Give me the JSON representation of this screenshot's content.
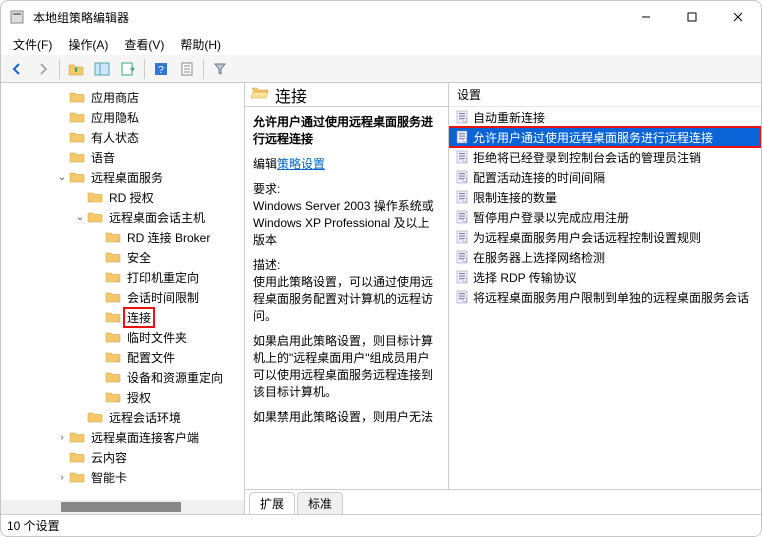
{
  "window": {
    "title": "本地组策略编辑器"
  },
  "menu": {
    "file": "文件(F)",
    "action": "操作(A)",
    "view": "查看(V)",
    "help": "帮助(H)"
  },
  "tree": {
    "items": [
      {
        "indent": 3,
        "twisty": "",
        "label": "应用商店",
        "sel": false
      },
      {
        "indent": 3,
        "twisty": "",
        "label": "应用隐私",
        "sel": false
      },
      {
        "indent": 3,
        "twisty": "",
        "label": "有人状态",
        "sel": false
      },
      {
        "indent": 3,
        "twisty": "",
        "label": "语音",
        "sel": false
      },
      {
        "indent": 3,
        "twisty": "v",
        "label": "远程桌面服务",
        "sel": false
      },
      {
        "indent": 4,
        "twisty": "",
        "label": "RD 授权",
        "sel": false
      },
      {
        "indent": 4,
        "twisty": "v",
        "label": "远程桌面会话主机",
        "sel": false
      },
      {
        "indent": 5,
        "twisty": "",
        "label": "RD 连接 Broker",
        "sel": false
      },
      {
        "indent": 5,
        "twisty": "",
        "label": "安全",
        "sel": false
      },
      {
        "indent": 5,
        "twisty": "",
        "label": "打印机重定向",
        "sel": false
      },
      {
        "indent": 5,
        "twisty": "",
        "label": "会话时间限制",
        "sel": false
      },
      {
        "indent": 5,
        "twisty": "",
        "label": "连接",
        "sel": true
      },
      {
        "indent": 5,
        "twisty": "",
        "label": "临时文件夹",
        "sel": false
      },
      {
        "indent": 5,
        "twisty": "",
        "label": "配置文件",
        "sel": false
      },
      {
        "indent": 5,
        "twisty": "",
        "label": "设备和资源重定向",
        "sel": false
      },
      {
        "indent": 5,
        "twisty": "",
        "label": "授权",
        "sel": false
      },
      {
        "indent": 4,
        "twisty": "",
        "label": "远程会话环境",
        "sel": false
      },
      {
        "indent": 3,
        "twisty": ">",
        "label": "远程桌面连接客户端",
        "sel": false
      },
      {
        "indent": 3,
        "twisty": "",
        "label": "云内容",
        "sel": false
      },
      {
        "indent": 3,
        "twisty": ">",
        "label": "智能卡",
        "sel": false
      }
    ]
  },
  "detail": {
    "header": "连接",
    "title": "允许用户通过使用远程桌面服务进行远程连接",
    "edit_label": "编辑",
    "edit_link": "策略设置",
    "req_label": "要求:",
    "req_text": "Windows Server 2003 操作系统或 Windows XP Professional 及以上版本",
    "desc_label": "描述:",
    "desc1": "使用此策略设置，可以通过使用远程桌面服务配置对计算机的远程访问。",
    "desc2": "如果启用此策略设置，则目标计算机上的\"远程桌面用户\"组成员用户可以使用远程桌面服务远程连接到该目标计算机。",
    "desc3": "如果禁用此策略设置，则用户无法"
  },
  "list": {
    "header": "设置",
    "items": [
      {
        "label": "自动重新连接",
        "sel": false
      },
      {
        "label": "允许用户通过使用远程桌面服务进行远程连接",
        "sel": true
      },
      {
        "label": "拒绝将已经登录到控制台会话的管理员注销",
        "sel": false
      },
      {
        "label": "配置活动连接的时间间隔",
        "sel": false
      },
      {
        "label": "限制连接的数量",
        "sel": false
      },
      {
        "label": "暂停用户登录以完成应用注册",
        "sel": false
      },
      {
        "label": "为远程桌面服务用户会话远程控制设置规则",
        "sel": false
      },
      {
        "label": "在服务器上选择网络检测",
        "sel": false
      },
      {
        "label": "选择 RDP 传输协议",
        "sel": false
      },
      {
        "label": "将远程桌面服务用户限制到单独的远程桌面服务会话",
        "sel": false
      }
    ]
  },
  "tabs": {
    "ext": "扩展",
    "std": "标准"
  },
  "status": {
    "text": "10 个设置"
  }
}
